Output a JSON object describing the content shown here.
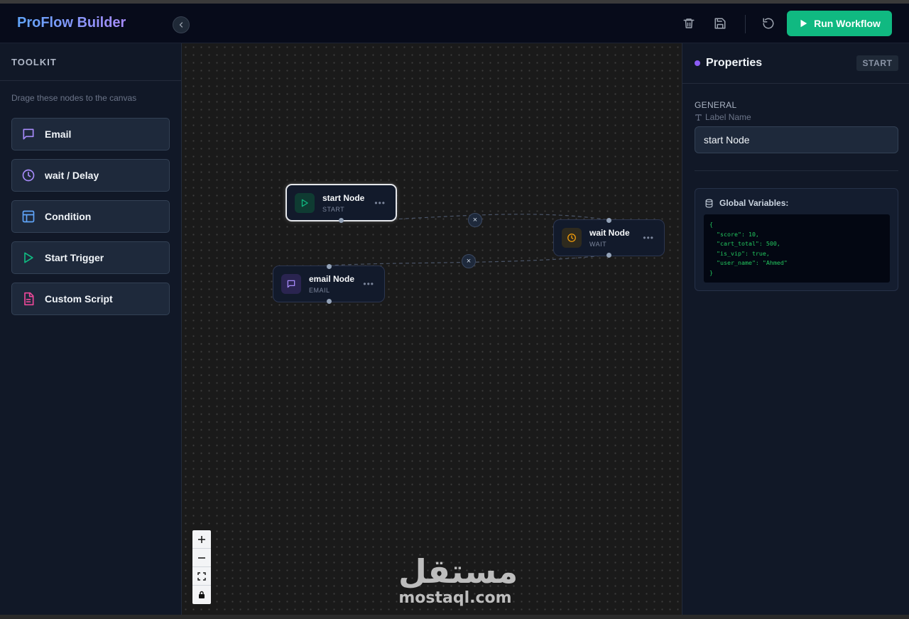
{
  "header": {
    "brand": "ProFlow Builder",
    "run_label": "Run Workflow",
    "icons": [
      "trash-icon",
      "save-icon",
      "undo-icon",
      "play-icon"
    ]
  },
  "toolkit": {
    "title": "TOOLKIT",
    "hint": "Drage these nodes to the canvas",
    "items": [
      {
        "label": "Email",
        "icon": "message-icon",
        "color": "#a78bfa"
      },
      {
        "label": "wait / Delay",
        "icon": "clock-icon",
        "color": "#a78bfa"
      },
      {
        "label": "Condition",
        "icon": "layout-icon",
        "color": "#60a5fa"
      },
      {
        "label": "Start Trigger",
        "icon": "play-icon",
        "color": "#10b981"
      },
      {
        "label": "Custom Script",
        "icon": "file-icon",
        "color": "#ec4899"
      }
    ]
  },
  "canvas": {
    "nodes": [
      {
        "id": "start",
        "title": "start Node",
        "type": "START",
        "icon": "play-icon",
        "color": "#10b981",
        "selected": true
      },
      {
        "id": "wait",
        "title": "wait Node",
        "type": "WAIT",
        "icon": "clock-icon",
        "color": "#f59e0b",
        "selected": false
      },
      {
        "id": "email",
        "title": "email Node",
        "type": "EMAIL",
        "icon": "message-icon",
        "color": "#a78bfa",
        "selected": false
      }
    ],
    "edge_delete_label": "×",
    "zoom_controls": [
      "+",
      "–",
      "fit",
      "lock"
    ]
  },
  "watermark": {
    "arabic": "مستقل",
    "latin": "mostaql.com"
  },
  "properties": {
    "title": "Properties",
    "badge": "START",
    "section": "GENERAL",
    "label_caption": "Label Name",
    "label_value": "start Node",
    "globals_title": "Global Variables:",
    "globals_code": "{\n  \"score\": 10,\n  \"cart_total\": 500,\n  \"is_vip\": true,\n  \"user_name\": \"Ahmed\"\n}"
  },
  "colors": {
    "accent": "#10b981",
    "brand_start": "#60a5fa",
    "brand_end": "#a78bfa",
    "code": "#22c55e"
  }
}
